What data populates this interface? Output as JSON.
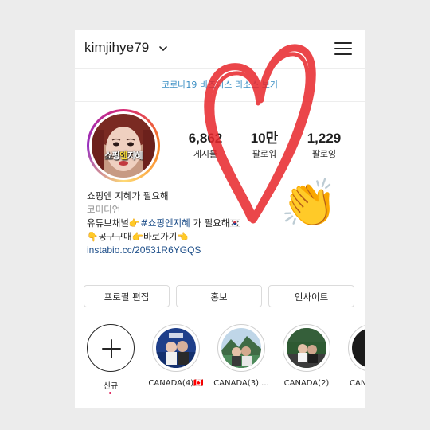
{
  "header": {
    "username": "kimjihye79",
    "banner": "코로나19 비즈니스 리소스 보기"
  },
  "profile": {
    "avatar_caption": {
      "pre": "쇼핑",
      "mid": "엔",
      "post": "지혜"
    },
    "stats": [
      {
        "value": "6,862",
        "label": "게시물"
      },
      {
        "value": "10만",
        "label": "팔로워"
      },
      {
        "value": "1,229",
        "label": "팔로잉"
      }
    ]
  },
  "bio": {
    "name": "쇼핑엔 지혜가 필요해",
    "category": "코미디언",
    "line1_pre": "유튜브채널👉",
    "line1_tag": "#쇼핑엔지혜",
    "line1_post": " 가 필요해🇰🇷",
    "line2": "👇공구구매👉바로가기👈",
    "link": "instabio.cc/20531R6YGQS"
  },
  "buttons": {
    "edit": "프로필 편집",
    "promotion": "홍보",
    "insights": "인사이트"
  },
  "highlights": [
    {
      "label": "신규",
      "icon": "plus-icon"
    },
    {
      "label": "CANADA(4)🇨🇦"
    },
    {
      "label": "CANADA(3) ..."
    },
    {
      "label": "CANADA(2)"
    },
    {
      "label": "CANA"
    }
  ],
  "decorations": {
    "heart_color": "#e8262b",
    "emoji": "👏"
  },
  "colors": {
    "link": "#1d4e89",
    "banner_text": "#3b8fc4",
    "muted": "#8e8e8e"
  }
}
